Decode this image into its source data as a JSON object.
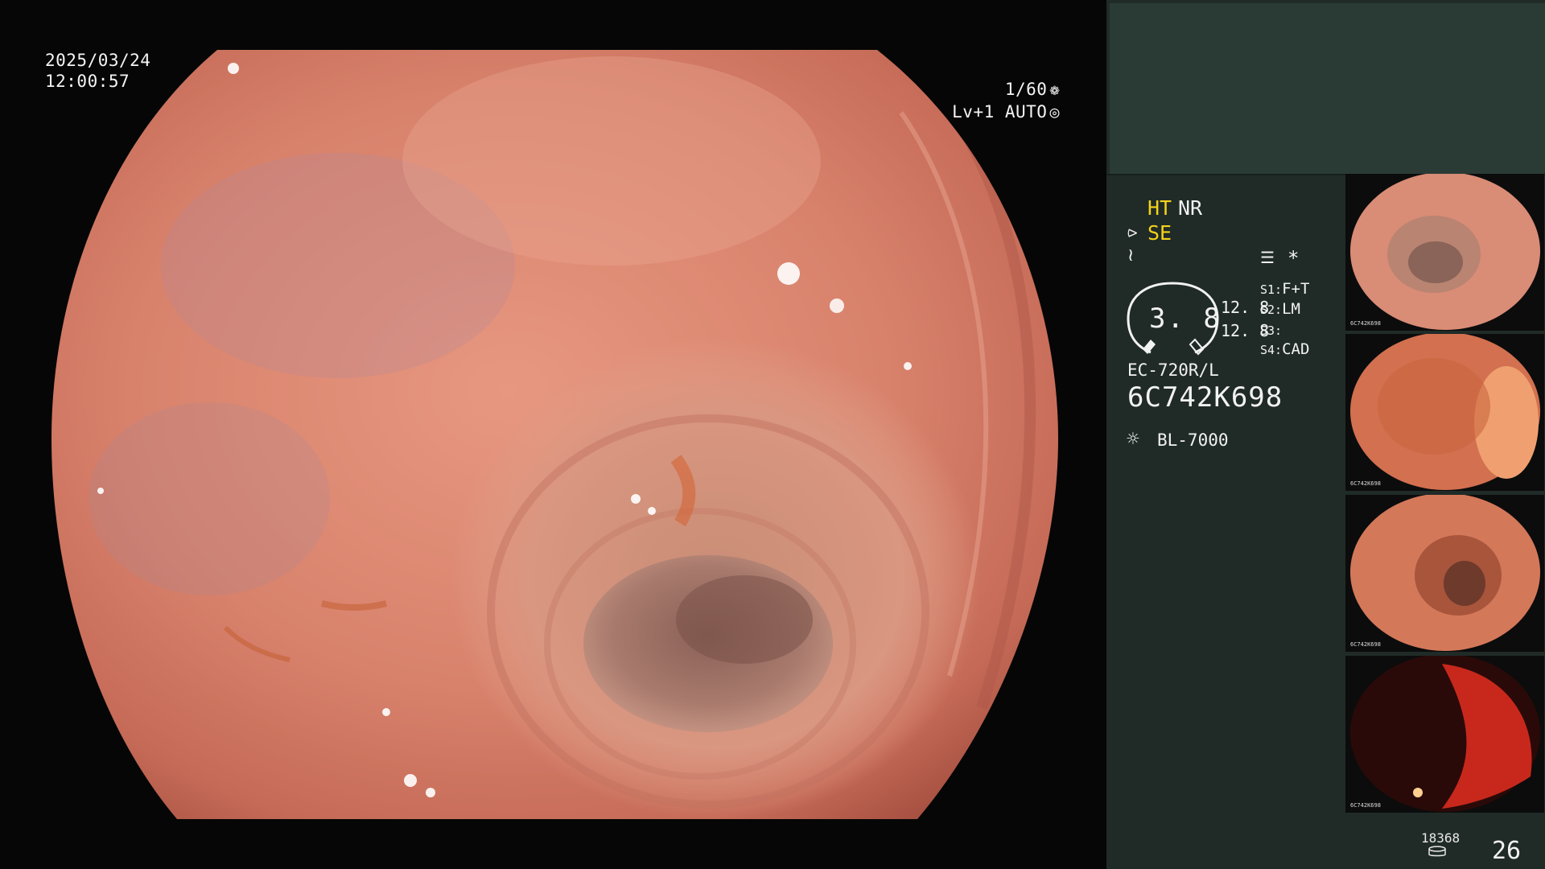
{
  "overlay": {
    "date": "2025/03/24",
    "time": "12:00:57",
    "shutter": "1/60",
    "shutter_icon": "aperture-icon",
    "level": "Lv+1 AUTO",
    "level_icon": "auto-iris-icon"
  },
  "panel": {
    "modes": {
      "ht": "HT",
      "nr": "NR",
      "se": "SE"
    },
    "icons": [
      "structure-enhance-icon",
      "color-enhance-icon",
      "menu-icon",
      "star-icon"
    ],
    "star": "*",
    "gauge_value": "3. 8",
    "values": [
      "12. 8",
      "12. 8"
    ],
    "slots": [
      {
        "key": "S1:",
        "value": "F+T"
      },
      {
        "key": "S2:",
        "value": "LM"
      },
      {
        "key": "S3:",
        "value": ""
      },
      {
        "key": "S4:",
        "value": "CAD"
      }
    ],
    "scope_model": "EC-720R/L",
    "serial": "6C742K698",
    "light_source": "BL-7000",
    "light_icon": "sun-icon"
  },
  "thumbnails": [
    {
      "serial": "6C742K698"
    },
    {
      "serial": "6C742K698"
    },
    {
      "serial": "6C742K698"
    },
    {
      "serial": "6C742K698"
    }
  ],
  "footer": {
    "image_count": "18368",
    "storage_icon": "storage-icon",
    "frame_number": "26"
  },
  "colors": {
    "panel_bg": "#202b28",
    "panel_top": "#2a3b36",
    "mode_accent": "#f4d21a",
    "mucosa": "#d97b66"
  }
}
